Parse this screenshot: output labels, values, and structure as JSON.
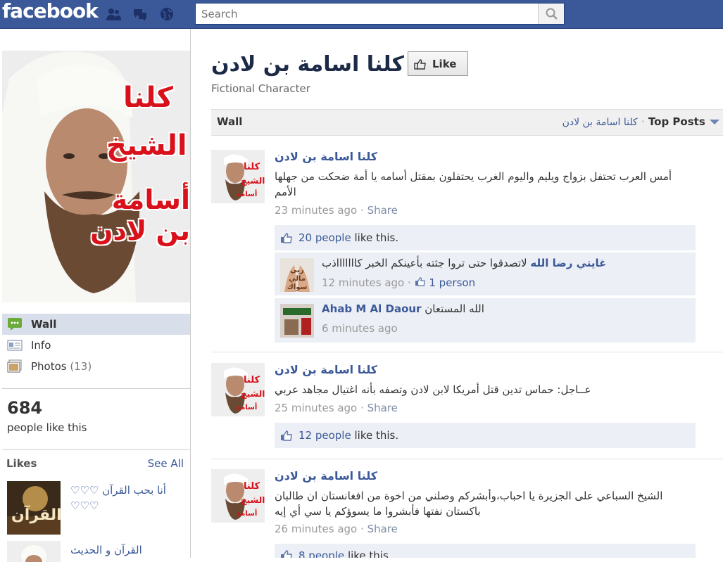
{
  "topbar": {
    "logo": "facebook",
    "search_placeholder": "Search"
  },
  "page": {
    "title": "كلنا اسامة بن لادن",
    "like_label": "Like",
    "category": "Fictional Character"
  },
  "profile": {
    "picture_text_1": "كلنا",
    "picture_text_2": "الشيخ",
    "picture_text_3": "أسامة بن لادن"
  },
  "nav": {
    "items": [
      {
        "label": "Wall"
      },
      {
        "label": "Info"
      },
      {
        "label": "Photos",
        "count": "(13)"
      }
    ]
  },
  "stats": {
    "likes_count": "684",
    "likes_text": "people like this"
  },
  "likes_section": {
    "header": "Likes",
    "see_all": "See All",
    "items": [
      {
        "title": "أنا بحب القرآن ♡♡♡ ♡♡♡",
        "thumb_text": "القرآن"
      },
      {
        "title": "القرآن و الحديث"
      }
    ]
  },
  "wall": {
    "header": "Wall",
    "filter_name": "كلنا اسامة بن لادن",
    "filter_dot": "·",
    "filter_label": "Top Posts"
  },
  "posts": [
    {
      "author": "كلنا اسامة بن لادن",
      "text": "أمس العرب تحتفل بزواج ويليم واليوم الغرب يحتفلون بمقتل أسامه يا أمة ضحكت من جهلها الأمم",
      "time": "23 minutes ago",
      "sep": "·",
      "share": "Share",
      "likes_link": "20 people",
      "likes_suffix": "like this.",
      "comments": [
        {
          "author": "غايتي رضا الله",
          "text": "لاتصدقوا حتى تروا جثته بأعينكم الخبر كاااااااذب",
          "time": "12 minutes ago",
          "sep": "·",
          "likes": "1 person",
          "thumb_text": "ربي مالي سواك"
        },
        {
          "author": "Ahab M Al Daour",
          "text": "الله المستعان",
          "time": "6 minutes ago"
        }
      ]
    },
    {
      "author": "كلنا اسامة بن لادن",
      "text": "عــاجل: حماس تدين قتل أمريكا لابن لادن وتصفه بأنه اغتيال مجاهد عربي",
      "time": "25 minutes ago",
      "sep": "·",
      "share": "Share",
      "likes_link": "12 people",
      "likes_suffix": "like this."
    },
    {
      "author": "كلنا اسامة بن لادن",
      "text": "الشيخ السباعي على الجزيرة يا احباب،وأبشركم وصلني من اخوة من افغانستان ان طالبان باكستان نفتها فأبشروا ما يسوؤكم يا سي أي إيه",
      "time": "26 minutes ago",
      "sep": "·",
      "share": "Share",
      "likes_link": "8 people",
      "likes_suffix": "like this."
    }
  ],
  "colors": {
    "brand": "#3b5998",
    "nav_selected": "#d8dfea",
    "like_box": "#eceff5"
  }
}
